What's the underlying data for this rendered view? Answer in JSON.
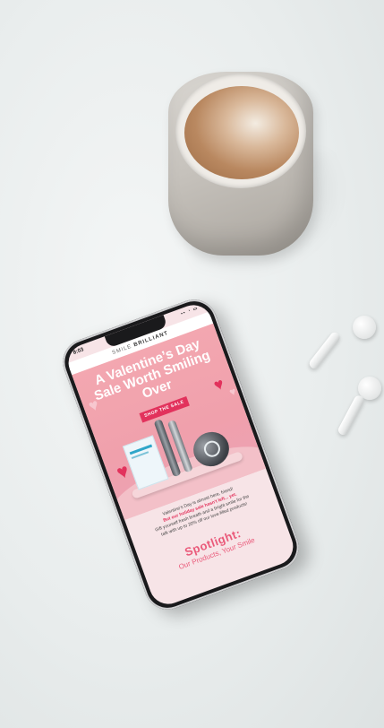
{
  "phone": {
    "status_time": "8:03",
    "status_icons": "▪▪ ◔ ▭",
    "brand_prefix": "SMILE",
    "brand_name": "BRILLIANT",
    "headline": "A Valentine’s Day Sale Worth Smiling Over",
    "cta_label": "SHOP THE SALE",
    "body_line1": "Valentine’s Day is almost here, friend!",
    "body_line2_accent": "But our holiday sale hasn’t left... yet.",
    "body_line3": "Gift yourself fresh breath and a bright smile for the",
    "body_line4": "talk with up to 20% off our love-filled products!",
    "spotlight_title": "Spotlight:",
    "spotlight_subtitle": "Our Products, Your Smile"
  },
  "colors": {
    "accent": "#e2325c",
    "hero_pink": "#f0a0ac",
    "spotlight": "#ea5a7a"
  }
}
